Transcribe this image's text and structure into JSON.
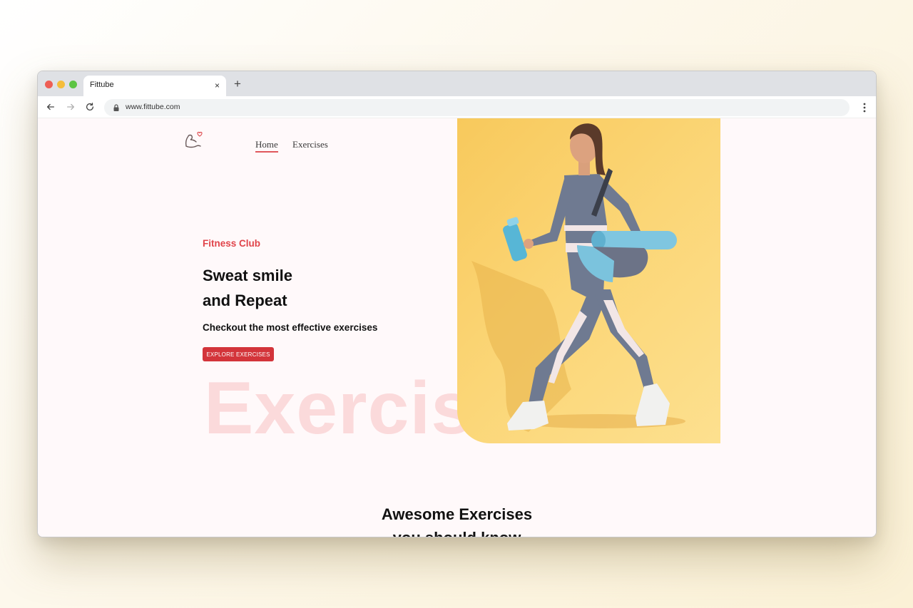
{
  "browser": {
    "tab_title": "Fittube",
    "url": "www.fittube.com",
    "close_glyph": "×",
    "newtab_glyph": "+"
  },
  "nav": {
    "home": "Home",
    "exercises": "Exercises"
  },
  "hero": {
    "subtitle": "Fitness Club",
    "headline_line1": "Sweat smile",
    "headline_line2": "and Repeat",
    "tagline": "Checkout the most effective exercises",
    "cta": "EXPLORE EXERCISES",
    "background_word": "Exercis"
  },
  "section": {
    "title_line1": "Awesome Exercises",
    "title_line2": "you should know"
  },
  "colors": {
    "accent": "#d3343a",
    "subtitle": "#e0444a",
    "watermark": "#fbdadb",
    "hero_bg": "#fbd677"
  },
  "icons": [
    "back-icon",
    "forward-icon",
    "reload-icon",
    "lock-icon",
    "menu-icon",
    "logo-icon"
  ]
}
